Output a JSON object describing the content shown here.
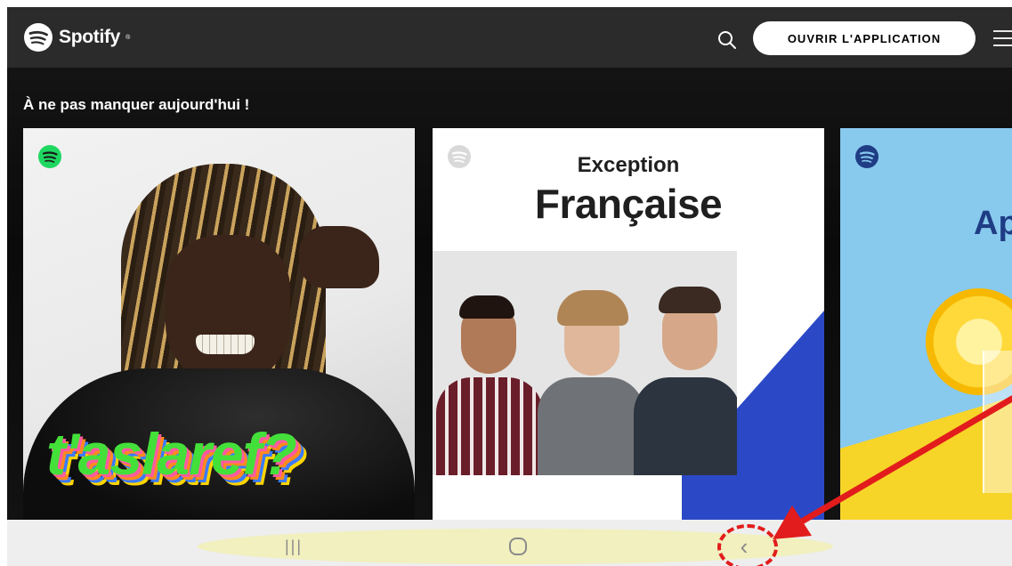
{
  "header": {
    "brand": "Spotify",
    "open_app_label": "OUVRIR L'APPLICATION",
    "search_icon": "search-icon",
    "menu_icon": "hamburger-menu-icon",
    "bar_color": "#2b2b2b"
  },
  "section": {
    "title": "À ne pas manquer aujourd'hui !"
  },
  "cards": [
    {
      "badge_color": "#1ed760",
      "cover_text": "t'aslaref?"
    },
    {
      "badge_color": "#d9d9d9",
      "title_line1": "Exception",
      "title_line2": "Française",
      "accent_color": "#2b49c7"
    },
    {
      "badge_color": "#1f3d84",
      "title_partial": "Ap"
    }
  ],
  "android_nav": {
    "recents_icon": "recent-apps-icon",
    "home_icon": "home-icon",
    "back_icon": "back-chevron-icon",
    "recents_glyph": "|||",
    "back_glyph": "‹"
  },
  "annotation": {
    "color": "#e21c1c",
    "highlight_color": "#f1f0b8"
  }
}
